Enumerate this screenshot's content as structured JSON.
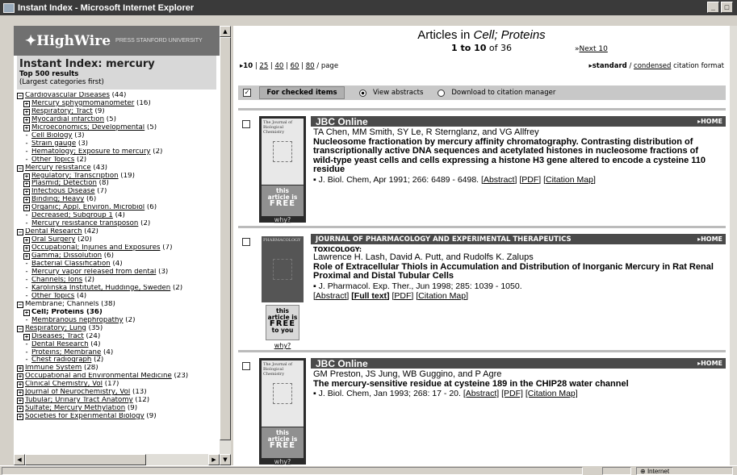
{
  "window": {
    "title": "Instant Index - Microsoft Internet Explorer",
    "btn_min": "_",
    "btn_max": "□"
  },
  "left": {
    "logo": "HighWire",
    "logo_small": "PRESS STANFORD UNIVERSITY",
    "heading": "Instant Index: mercury",
    "top_results": "Top 500 results",
    "largest_first": "(Largest categories first)",
    "tree": [
      {
        "level": 0,
        "mark": "⊟",
        "text": "Cardiovascular Diseases",
        "count": " (44)",
        "link": true
      },
      {
        "level": 1,
        "mark": "⊞",
        "text": "Mercury sphygmomanometer",
        "count": " (16)",
        "link": true
      },
      {
        "level": 1,
        "mark": "⊞",
        "text": "Respiratory; Tract",
        "count": " (9)",
        "link": true
      },
      {
        "level": 1,
        "mark": "⊞",
        "text": "Myocardial infarction",
        "count": " (5)",
        "link": true
      },
      {
        "level": 1,
        "mark": "⊞",
        "text": "Microeconomics; Developmental",
        "count": " (5)",
        "link": true
      },
      {
        "level": 1,
        "mark": "-",
        "text": "Cell Biology",
        "count": " (3)",
        "link": true
      },
      {
        "level": 1,
        "mark": "-",
        "text": "Strain gauge",
        "count": " (3)",
        "link": true
      },
      {
        "level": 1,
        "mark": "-",
        "text": "Hematology; Exposure to mercury",
        "count": " (2)",
        "link": true
      },
      {
        "level": 1,
        "mark": "-",
        "text": "Other Topics",
        "count": " (2)",
        "link": true
      },
      {
        "level": 0,
        "mark": "⊟",
        "text": "Mercury resistance",
        "count": " (43)",
        "link": true
      },
      {
        "level": 1,
        "mark": "⊞",
        "text": "Regulatory; Transcription",
        "count": " (19)",
        "link": true
      },
      {
        "level": 1,
        "mark": "⊞",
        "text": "Plasmid; Detection",
        "count": " (8)",
        "link": true
      },
      {
        "level": 1,
        "mark": "⊞",
        "text": "Infectious Disease",
        "count": " (7)",
        "link": true
      },
      {
        "level": 1,
        "mark": "⊞",
        "text": "Binding; Heavy",
        "count": " (6)",
        "link": true
      },
      {
        "level": 1,
        "mark": "⊞",
        "text": "Organic; Appl. Environ. Microbiol",
        "count": " (6)",
        "link": true
      },
      {
        "level": 1,
        "mark": "-",
        "text": "Decreased; Subgroup 1",
        "count": " (4)",
        "link": true
      },
      {
        "level": 1,
        "mark": "-",
        "text": "Mercury resistance transposon",
        "count": " (2)",
        "link": true
      },
      {
        "level": 0,
        "mark": "⊟",
        "text": "Dental Research",
        "count": " (42)",
        "link": true
      },
      {
        "level": 1,
        "mark": "⊞",
        "text": "Oral Surgery",
        "count": " (20)",
        "link": true
      },
      {
        "level": 1,
        "mark": "⊞",
        "text": "Occupational; Injuries and Exposures",
        "count": " (7)",
        "link": true
      },
      {
        "level": 1,
        "mark": "⊞",
        "text": "Gamma; Dissolution",
        "count": " (6)",
        "link": true
      },
      {
        "level": 1,
        "mark": "-",
        "text": "Bacterial Classification",
        "count": " (4)",
        "link": true
      },
      {
        "level": 1,
        "mark": "-",
        "text": "Mercury vapor released from dental",
        "count": " (3)",
        "link": true
      },
      {
        "level": 1,
        "mark": "-",
        "text": "Channels; Ions",
        "count": " (2)",
        "link": true
      },
      {
        "level": 1,
        "mark": "-",
        "text": "Karolinska Institutet, Huddinge, Sweden",
        "count": " (2)",
        "link": true
      },
      {
        "level": 1,
        "mark": "-",
        "text": "Other Topics",
        "count": " (4)",
        "link": true
      },
      {
        "level": 0,
        "mark": "⊟",
        "text": "Membrane; Channels",
        "count": " (38)",
        "link": false
      },
      {
        "level": 1,
        "mark": "⊞",
        "text": "Cell; Proteins",
        "count": " (36)",
        "link": false,
        "bold": true
      },
      {
        "level": 1,
        "mark": "-",
        "text": "Membranous nephropathy",
        "count": " (2)",
        "link": true
      },
      {
        "level": 0,
        "mark": "⊟",
        "text": "Respiratory; Lung",
        "count": " (35)",
        "link": true
      },
      {
        "level": 1,
        "mark": "⊞",
        "text": "Diseases; Tract",
        "count": " (24)",
        "link": true
      },
      {
        "level": 1,
        "mark": "-",
        "text": "Dental Research",
        "count": " (4)",
        "link": true
      },
      {
        "level": 1,
        "mark": "-",
        "text": "Proteins; Membrane",
        "count": " (4)",
        "link": true
      },
      {
        "level": 1,
        "mark": "-",
        "text": "Chest radiograph",
        "count": " (2)",
        "link": true
      },
      {
        "level": 0,
        "mark": "⊞",
        "text": "Immune System",
        "count": " (28)",
        "link": true
      },
      {
        "level": 0,
        "mark": "⊞",
        "text": "Occupational and Environmental Medicine",
        "count": " (23)",
        "link": true
      },
      {
        "level": 0,
        "mark": "⊞",
        "text": "Clinical Chemistry, Vol",
        "count": " (17)",
        "link": true
      },
      {
        "level": 0,
        "mark": "⊞",
        "text": "Journal of Neurochemistry, Vol",
        "count": " (13)",
        "link": true
      },
      {
        "level": 0,
        "mark": "⊞",
        "text": "Tubular; Urinary Tract Anatomy",
        "count": " (12)",
        "link": true
      },
      {
        "level": 0,
        "mark": "⊞",
        "text": "Sulfate; Mercury Methylation",
        "count": " (9)",
        "link": true
      },
      {
        "level": 0,
        "mark": "⊞",
        "text": "Societies for Experimental Biology",
        "count": " (9)",
        "link": true
      }
    ]
  },
  "right": {
    "title_prefix": "Articles in ",
    "title_em": "Cell; Proteins",
    "range": "1 to 10",
    "of_total": " of 36",
    "next_arrow": "»",
    "next_label": "Next 10",
    "page_sizes": {
      "current": "10",
      "opt1": "25",
      "opt2": "40",
      "opt3": "60",
      "opt4": "80",
      "suffix": " / page"
    },
    "format": {
      "standard": "standard",
      "condensed": "condensed",
      "suffix": " citation format"
    },
    "checkbar": {
      "check_mark": "✓",
      "for_checked": "For checked items",
      "view_abstracts": "View abstracts",
      "download": "Download to citation manager"
    },
    "articles": [
      {
        "journal": "JBC Online",
        "home": "HOME",
        "cover_title": "The Journal of Biological Chemistry",
        "free": [
          "this",
          "article is",
          "FREE"
        ],
        "why": "why?",
        "section": "",
        "authors": "TA Chen, MM Smith, SY Le, R Sternglanz, and VG Allfrey",
        "title": "Nucleosome fractionation by mercury affinity chromatography. Contrasting distribution of transcriptionally active DNA sequences and acetylated histones in nucleosome fractions of wild-type yeast cells and cells expressing a histone H3 gene altered to encode a cysteine 110 residue",
        "citation": "J. Biol. Chem, Apr 1991; 266: 6489 - 6498.",
        "links": [
          "[Abstract]",
          "[PDF]",
          "[Citation Map]"
        ]
      },
      {
        "journal": "JOURNAL OF PHARMACOLOGY AND EXPERIMENTAL THERAPEUTICS",
        "home": "HOME",
        "cover_title": "PHARMACOLOGY",
        "free": [
          "this",
          "article is",
          "FREE",
          "to you"
        ],
        "why": "why?",
        "section": "TOXICOLOGY:",
        "authors": "Lawrence H. Lash, David A. Putt, and Rudolfs K. Zalups",
        "title": "Role of Extracellular Thiols in Accumulation and Distribution of Inorganic Mercury in Rat Renal Proximal and Distal Tubular Cells",
        "citation": "J. Pharmacol. Exp. Ther., Jun 1998; 285: 1039 - 1050.",
        "links": [
          "[Abstract]",
          "[Full text]",
          "[PDF]",
          "[Citation Map]"
        ]
      },
      {
        "journal": "JBC Online",
        "home": "HOME",
        "cover_title": "The Journal of Biological Chemistry",
        "free": [
          "this",
          "article is",
          "FREE"
        ],
        "why": "why?",
        "section": "",
        "authors": "GM Preston, JS Jung, WB Guggino, and P Agre",
        "title": "The mercury-sensitive residue at cysteine 189 in the CHIP28 water channel",
        "citation": "J. Biol. Chem, Jan 1993; 268: 17 - 20.",
        "links": [
          "[Abstract]",
          "[PDF]",
          "[Citation Map]"
        ]
      }
    ]
  },
  "status": {
    "zone": "Internet"
  }
}
